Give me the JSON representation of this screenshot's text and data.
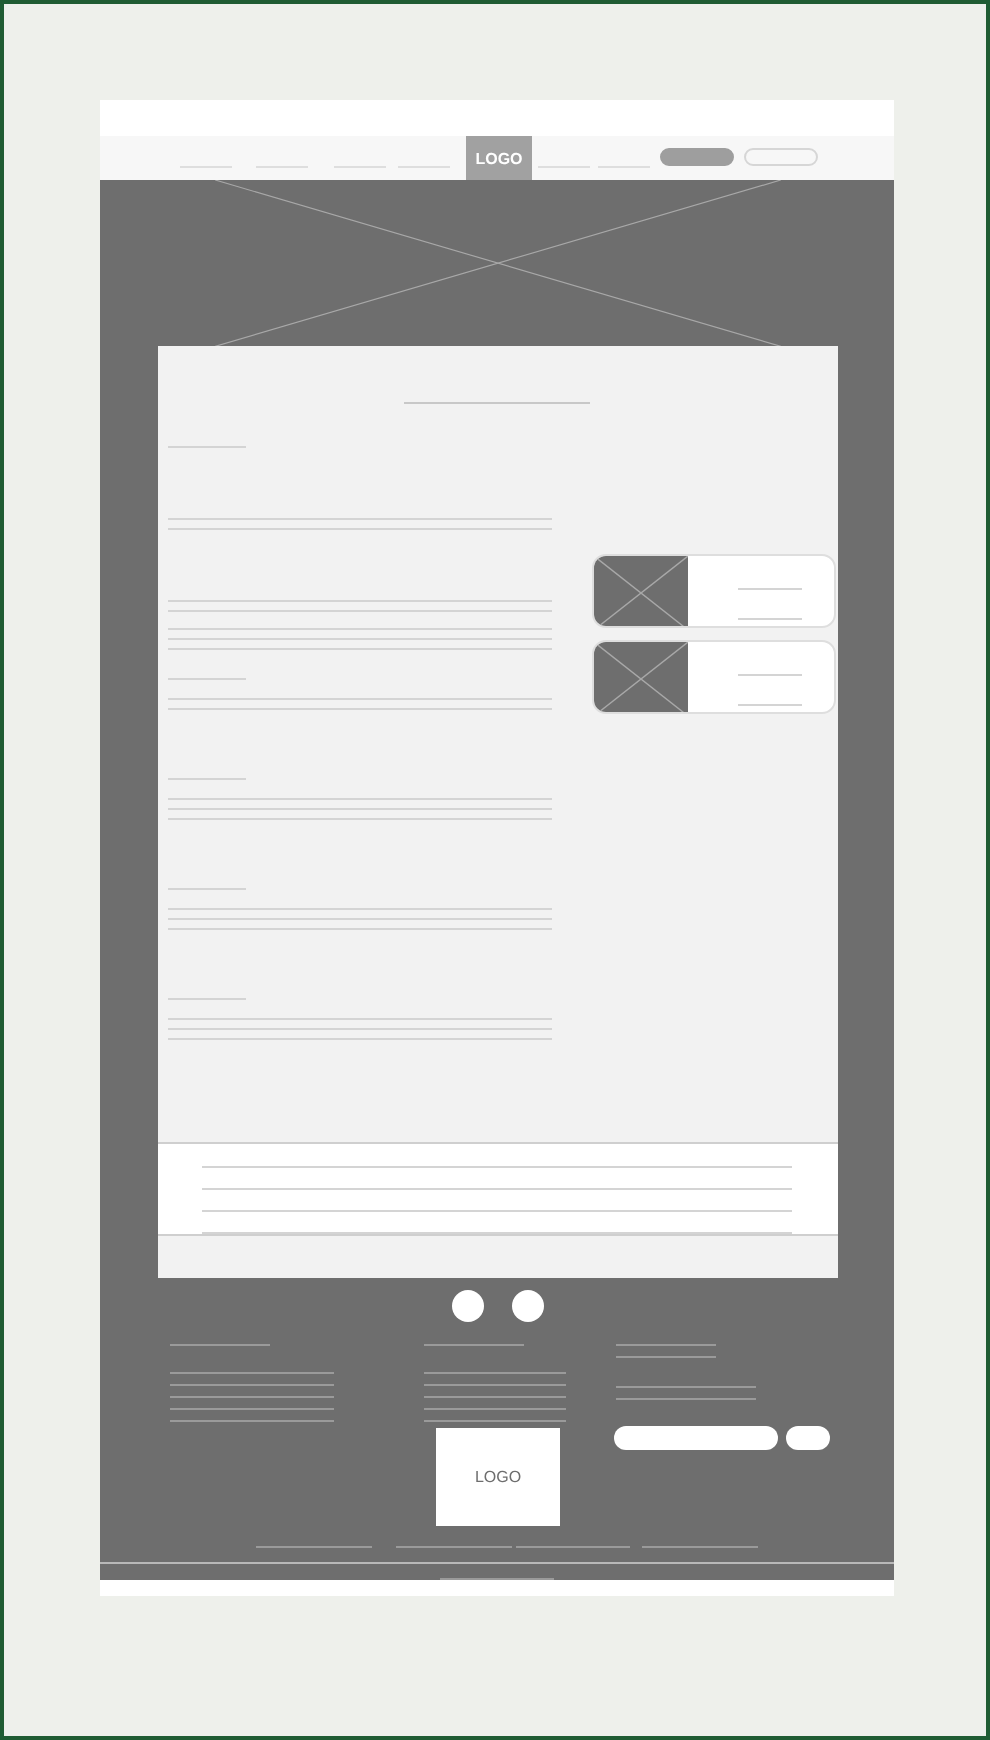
{
  "header": {
    "logo": "LOGO"
  },
  "footer": {
    "logo": "LOGO"
  }
}
